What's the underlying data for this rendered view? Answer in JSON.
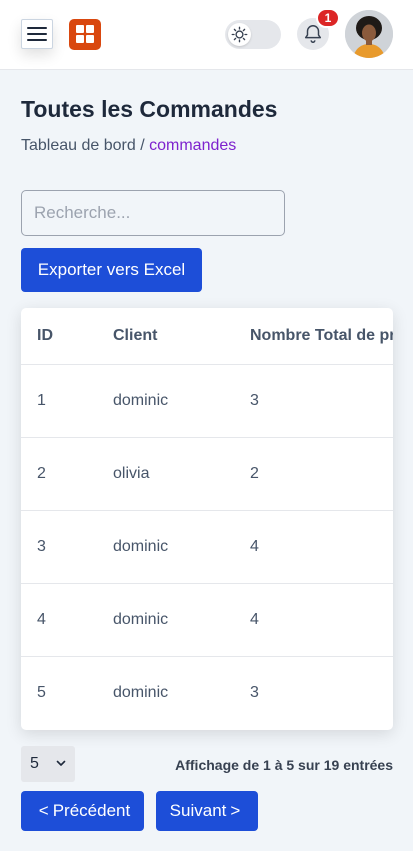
{
  "header": {
    "notification_count": "1",
    "theme_icon": "sun-icon",
    "brand_color": "#d9480f",
    "accent_color": "#1d4ed8"
  },
  "page": {
    "title": "Toutes les Commandes",
    "breadcrumb_root": "Tableau de bord",
    "breadcrumb_separator": "/",
    "breadcrumb_current": "commandes"
  },
  "search": {
    "placeholder": "Recherche...",
    "value": ""
  },
  "export_label": "Exporter vers Excel",
  "table": {
    "columns": [
      "ID",
      "Client",
      "Nombre Total de pr"
    ],
    "rows": [
      [
        "1",
        "dominic",
        "3"
      ],
      [
        "2",
        "olivia",
        "2"
      ],
      [
        "3",
        "dominic",
        "4"
      ],
      [
        "4",
        "dominic",
        "4"
      ],
      [
        "5",
        "dominic",
        "3"
      ]
    ]
  },
  "pagination": {
    "page_size": "5",
    "info": "Affichage de 1 à 5 sur 19 entrées",
    "prev_label": "Précédent",
    "next_label": "Suivant",
    "prev_arrow": "<",
    "next_arrow": ">"
  }
}
